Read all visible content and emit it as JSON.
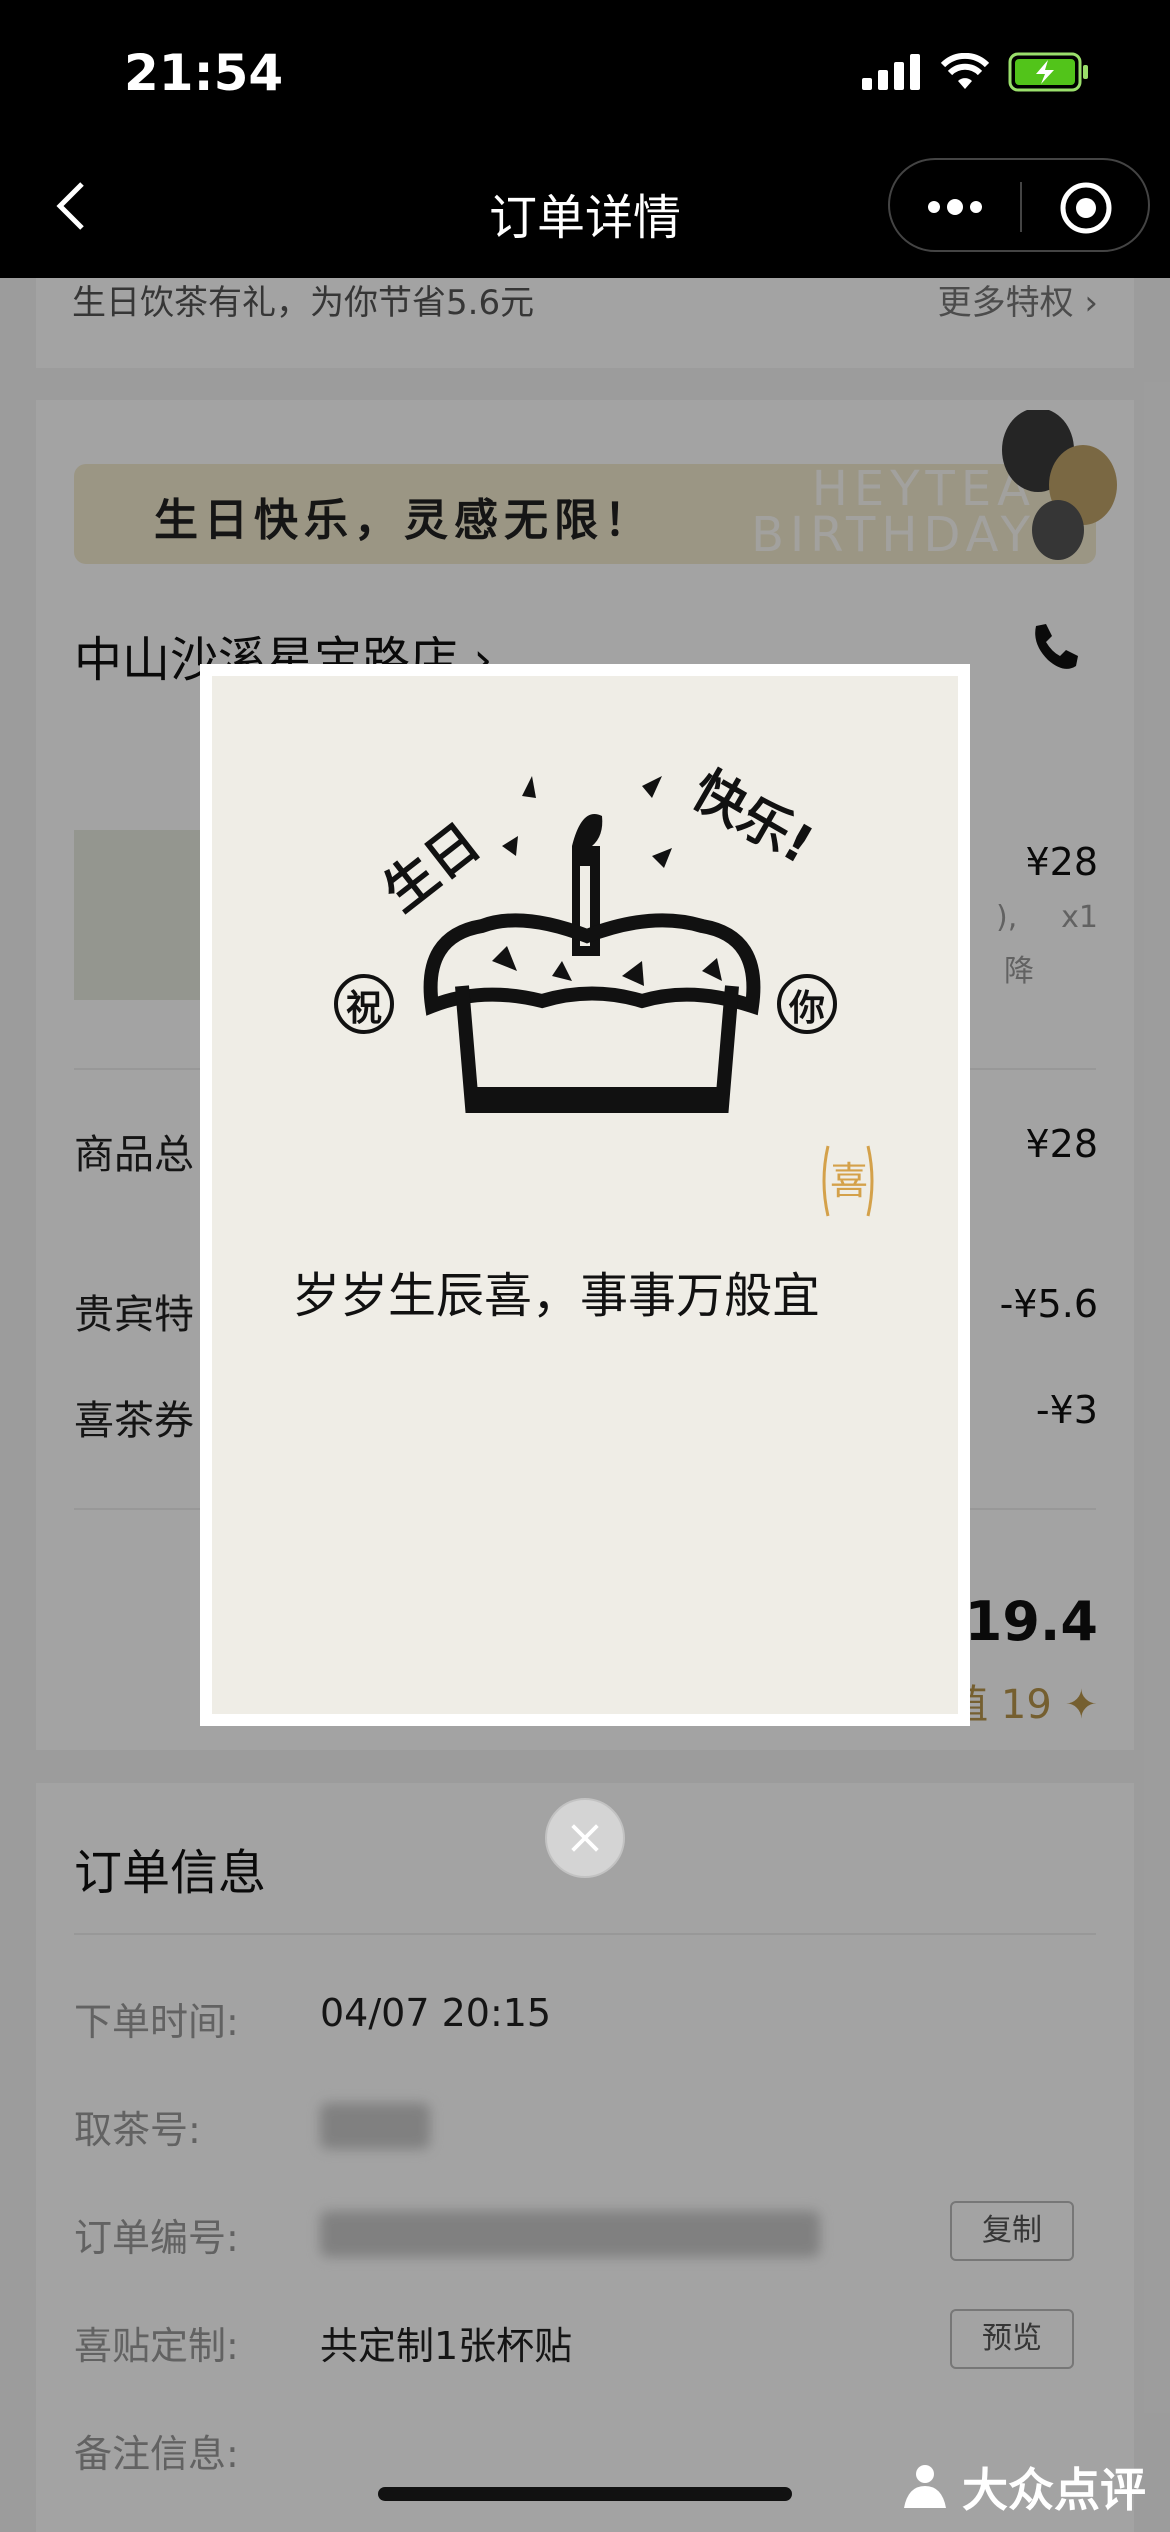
{
  "status": {
    "time": "21:54"
  },
  "nav": {
    "title": "订单详情"
  },
  "promo": {
    "text": "生日饮茶有礼，为你节省5.6元",
    "more": "更多特权 ›"
  },
  "birthday_banner": {
    "text": "生日快乐，灵感无限！",
    "deco_line1": "HEYTEA",
    "deco_line2": "BIRTHDAY"
  },
  "store": {
    "name": "中山沙溪星宝路店 ›"
  },
  "product": {
    "price": "¥28",
    "qty": "x1",
    "note_fragment": "),",
    "discount_fragment": "降"
  },
  "summary": {
    "goods_total_label": "商品总",
    "goods_total_value": "¥28",
    "vip_label": "贵宾特",
    "vip_value": "-¥5.6",
    "coupon_label": "喜茶券",
    "coupon_value": "-¥3",
    "total": "¥19.4",
    "points": "值 19 ✦"
  },
  "order_info": {
    "title": "订单信息",
    "rows": [
      {
        "label": "下单时间:",
        "value": "04/07 20:15"
      },
      {
        "label": "取茶号:",
        "value": ""
      },
      {
        "label": "订单编号:",
        "value": ""
      },
      {
        "label": "喜贴定制:",
        "value": "共定制1张杯贴"
      },
      {
        "label": "备注信息:",
        "value": ""
      }
    ],
    "copy_label": "复制",
    "preview_label": "预览"
  },
  "modal": {
    "cake_text_left": "生日",
    "cake_text_right": "快乐!",
    "bless_left": "祝",
    "bless_right": "你",
    "stamp": "喜",
    "wish": "岁岁生辰喜，事事万般宜"
  },
  "watermark": {
    "text": "大众点评"
  }
}
